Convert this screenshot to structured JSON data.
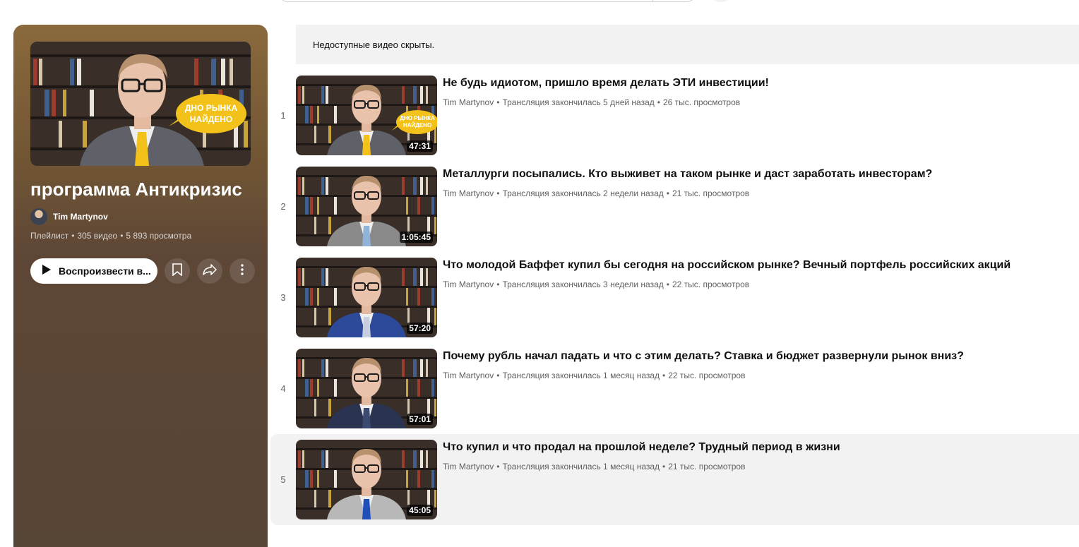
{
  "playlist": {
    "title": "программа Антикризис",
    "owner": "Tim Martynov",
    "type_label": "Плейлист",
    "video_count": "305 видео",
    "views": "5 893 просмотра",
    "play_all_label": "Воспроизвести в...",
    "thumb_badge_line1": "ДНО РЫНКА",
    "thumb_badge_line2": "НАЙДЕНО",
    "icons": [
      "play-icon",
      "save-icon",
      "share-icon",
      "more-icon"
    ]
  },
  "notice": "Недоступные видео скрыты.",
  "videos": [
    {
      "index": "1",
      "title": "Не будь идиотом, пришло время делать ЭТИ инвестиции!",
      "channel": "Tim Martynov",
      "status": "Трансляция закончилась 5 дней назад",
      "views": "26 тыс. просмотров",
      "duration": "47:31",
      "badge_line1": "ДНО РЫНКА",
      "badge_line2": "НАЙДЕНО",
      "jacket": "#5f6068",
      "tie": "#f2c21a"
    },
    {
      "index": "2",
      "title": "Металлурги посыпались. Кто выживет на таком рынке и даст заработать инвесторам?",
      "channel": "Tim Martynov",
      "status": "Трансляция закончилась 2 недели назад",
      "views": "21 тыс. просмотров",
      "duration": "1:05:45",
      "jacket": "#8a8a8a",
      "tie": "#8fb4d8"
    },
    {
      "index": "3",
      "title": "Что молодой Баффет купил бы сегодня на российском рынке? Вечный портфель российских акций",
      "channel": "Tim Martynov",
      "status": "Трансляция закончилась 3 недели назад",
      "views": "22 тыс. просмотров",
      "duration": "57:20",
      "jacket": "#2d4a9a",
      "tie": "#c9cde0"
    },
    {
      "index": "4",
      "title": "Почему рубль начал падать и что с этим делать? Ставка и бюджет развернули рынок вниз?",
      "channel": "Tim Martynov",
      "status": "Трансляция закончилась 1 месяц назад",
      "views": "22 тыс. просмотров",
      "duration": "57:01",
      "jacket": "#2a3350",
      "tie": "#3b4a70"
    },
    {
      "index": "5",
      "title": "Что купил и что продал на прошлой неделе? Трудный период в жизни",
      "channel": "Tim Martynov",
      "status": "Трансляция закончилась 1 месяц назад",
      "views": "21 тыс. просмотров",
      "duration": "45:05",
      "jacket": "#b8b8b8",
      "tie": "#1f4fb8"
    }
  ],
  "colors": {
    "panel_top": "#8a6a3c",
    "panel_bottom": "#574536",
    "badge": "#f2c21a"
  }
}
